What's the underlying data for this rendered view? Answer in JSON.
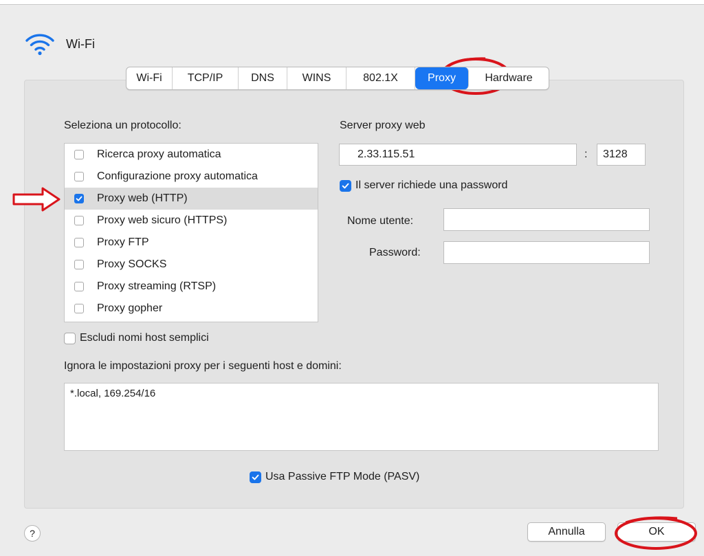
{
  "window": {
    "title": "Wi-Fi"
  },
  "tabs": [
    {
      "label": "Wi-Fi",
      "active": false
    },
    {
      "label": "TCP/IP",
      "active": false
    },
    {
      "label": "DNS",
      "active": false
    },
    {
      "label": "WINS",
      "active": false
    },
    {
      "label": "802.1X",
      "active": false
    },
    {
      "label": "Proxy",
      "active": true
    },
    {
      "label": "Hardware",
      "active": false
    }
  ],
  "protocols": {
    "label": "Seleziona un protocollo:",
    "items": [
      {
        "label": "Ricerca proxy automatica",
        "checked": false
      },
      {
        "label": "Configurazione proxy automatica",
        "checked": false
      },
      {
        "label": "Proxy web (HTTP)",
        "checked": true,
        "selected": true
      },
      {
        "label": "Proxy web sicuro (HTTPS)",
        "checked": false
      },
      {
        "label": "Proxy FTP",
        "checked": false
      },
      {
        "label": "Proxy SOCKS",
        "checked": false
      },
      {
        "label": "Proxy streaming (RTSP)",
        "checked": false
      },
      {
        "label": "Proxy gopher",
        "checked": false
      }
    ]
  },
  "server": {
    "label": "Server proxy web",
    "address": "2.33.115.51",
    "separator": ":",
    "port": "3128",
    "requires_password_label": "Il server richiede una password",
    "requires_password": true,
    "username_label": "Nome utente:",
    "username": "",
    "password_label": "Password:",
    "password": ""
  },
  "exclude_simple": {
    "label": "Escludi nomi host semplici",
    "checked": false
  },
  "bypass": {
    "label": "Ignora le impostazioni proxy per i seguenti host e domini:",
    "value": "*.local, 169.254/16"
  },
  "passive_ftp": {
    "label": "Usa Passive FTP Mode (PASV)",
    "checked": true
  },
  "buttons": {
    "help": "?",
    "cancel": "Annulla",
    "ok": "OK"
  },
  "colors": {
    "accent": "#1a74ea",
    "annotation": "#d9141b"
  },
  "icons": {
    "wifi": "wifi-icon",
    "check": "checkmark-icon"
  }
}
